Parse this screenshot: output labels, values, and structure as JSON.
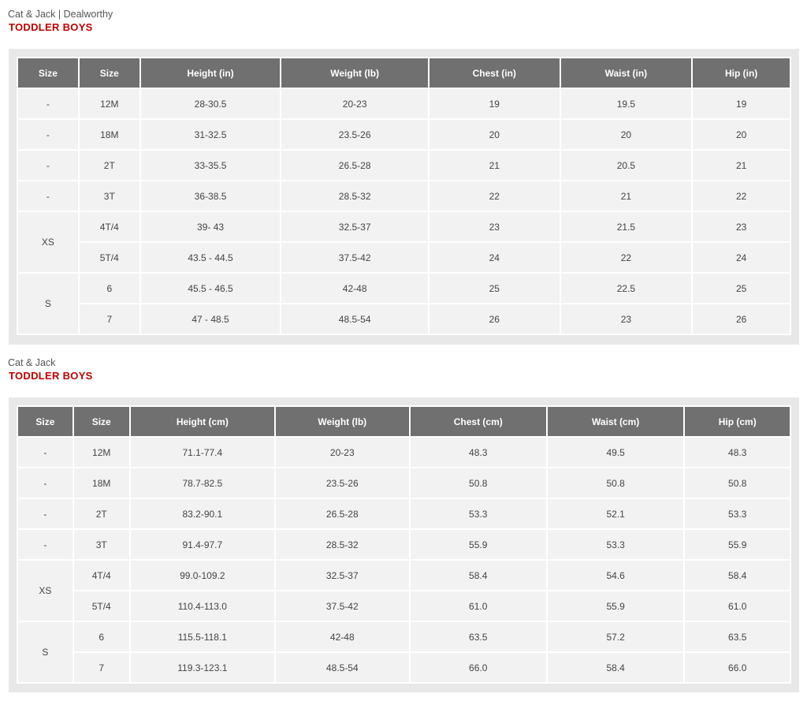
{
  "section1": {
    "brand": "Cat & Jack | Dealworthy",
    "subtitle": "TODDLER BOYS",
    "headers": [
      "Size",
      "Size",
      "Height (in)",
      "Weight (lb)",
      "Chest (in)",
      "Waist (in)",
      "Hip (in)"
    ],
    "groups": [
      {
        "label": "-",
        "rows": [
          [
            "12M",
            "28-30.5",
            "20-23",
            "19",
            "19.5",
            "19"
          ]
        ]
      },
      {
        "label": "-",
        "rows": [
          [
            "18M",
            "31-32.5",
            "23.5-26",
            "20",
            "20",
            "20"
          ]
        ]
      },
      {
        "label": "-",
        "rows": [
          [
            "2T",
            "33-35.5",
            "26.5-28",
            "21",
            "20.5",
            "21"
          ]
        ]
      },
      {
        "label": "-",
        "rows": [
          [
            "3T",
            "36-38.5",
            "28.5-32",
            "22",
            "21",
            "22"
          ]
        ]
      },
      {
        "label": "XS",
        "rows": [
          [
            "4T/4",
            "39- 43",
            "32.5-37",
            "23",
            "21.5",
            "23"
          ],
          [
            "5T/4",
            "43.5 - 44.5",
            "37.5-42",
            "24",
            "22",
            "24"
          ]
        ]
      },
      {
        "label": "S",
        "rows": [
          [
            "6",
            "45.5 - 46.5",
            "42-48",
            "25",
            "22.5",
            "25"
          ],
          [
            "7",
            "47 - 48.5",
            "48.5-54",
            "26",
            "23",
            "26"
          ]
        ]
      }
    ]
  },
  "section2": {
    "brand": "Cat & Jack",
    "subtitle": "TODDLER BOYS",
    "headers": [
      "Size",
      "Size",
      "Height (cm)",
      "Weight (lb)",
      "Chest (cm)",
      "Waist (cm)",
      "Hip (cm)"
    ],
    "groups": [
      {
        "label": "-",
        "rows": [
          [
            "12M",
            "71.1-77.4",
            "20-23",
            "48.3",
            "49.5",
            "48.3"
          ]
        ]
      },
      {
        "label": "-",
        "rows": [
          [
            "18M",
            "78.7-82.5",
            "23.5-26",
            "50.8",
            "50.8",
            "50.8"
          ]
        ]
      },
      {
        "label": "-",
        "rows": [
          [
            "2T",
            "83.2-90.1",
            "26.5-28",
            "53.3",
            "52.1",
            "53.3"
          ]
        ]
      },
      {
        "label": "-",
        "rows": [
          [
            "3T",
            "91.4-97.7",
            "28.5-32",
            "55.9",
            "53.3",
            "55.9"
          ]
        ]
      },
      {
        "label": "XS",
        "rows": [
          [
            "4T/4",
            "99.0-109.2",
            "32.5-37",
            "58.4",
            "54.6",
            "58.4"
          ],
          [
            "5T/4",
            "110.4-113.0",
            "37.5-42",
            "61.0",
            "55.9",
            "61.0"
          ]
        ]
      },
      {
        "label": "S",
        "rows": [
          [
            "6",
            "115.5-118.1",
            "42-48",
            "63.5",
            "57.2",
            "63.5"
          ],
          [
            "7",
            "119.3-123.1",
            "48.5-54",
            "66.0",
            "58.4",
            "66.0"
          ]
        ]
      }
    ]
  }
}
